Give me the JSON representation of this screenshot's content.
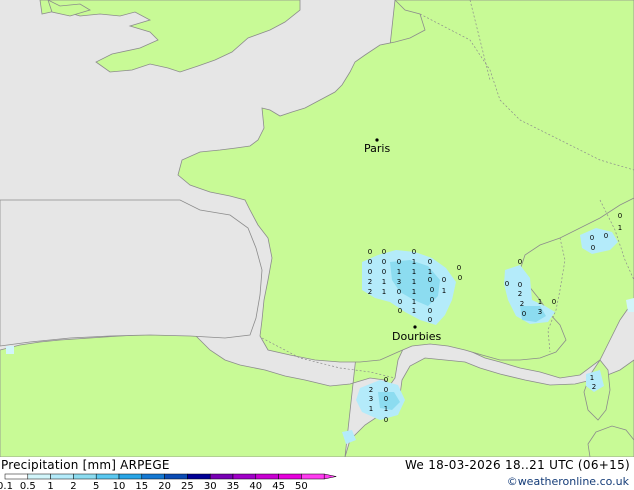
{
  "footer": {
    "title": "Precipitation [mm]  ARPEGE",
    "datetime": "We 18-03-2026 18..21 UTC (06+15)",
    "credit": "©weatheronline.co.uk"
  },
  "colors": {
    "sea": "#e6e6e6",
    "land": "#c8fa96",
    "border": "#8c8c8c",
    "coast": "#8c8c8c"
  },
  "cities": [
    {
      "name": "Paris"
    },
    {
      "name": "Dourbies"
    }
  ],
  "legend": {
    "ticks": [
      "0.1",
      "0.5",
      "1",
      "2",
      "5",
      "10",
      "15",
      "20",
      "25",
      "30",
      "35",
      "40",
      "45",
      "50"
    ],
    "colors": [
      "#ffffff",
      "#d2f5fa",
      "#b4ebfa",
      "#8cdcf0",
      "#5ac8f0",
      "#28a5e6",
      "#1478d2",
      "#0a4bb4",
      "#000096",
      "#7800b4",
      "#a000c8",
      "#c800d2",
      "#e600dc",
      "#ff3cf0"
    ]
  },
  "precip_values": [
    "0",
    "0",
    "0",
    "0",
    "0",
    "0",
    "1",
    "0",
    "0",
    "0",
    "0",
    "1",
    "1",
    "1",
    "0",
    "0",
    "2",
    "1",
    "3",
    "1",
    "0",
    "1",
    "0",
    "2",
    "1",
    "0",
    "1",
    "0",
    "0",
    "1",
    "0",
    "0",
    "1",
    "0",
    "0",
    "0",
    "0",
    "2",
    "2",
    "1",
    "0",
    "0",
    "3",
    "0",
    "1",
    "0",
    "0",
    "0",
    "0",
    "2",
    "0",
    "3",
    "0",
    "1",
    "1",
    "0",
    "1",
    "2"
  ]
}
